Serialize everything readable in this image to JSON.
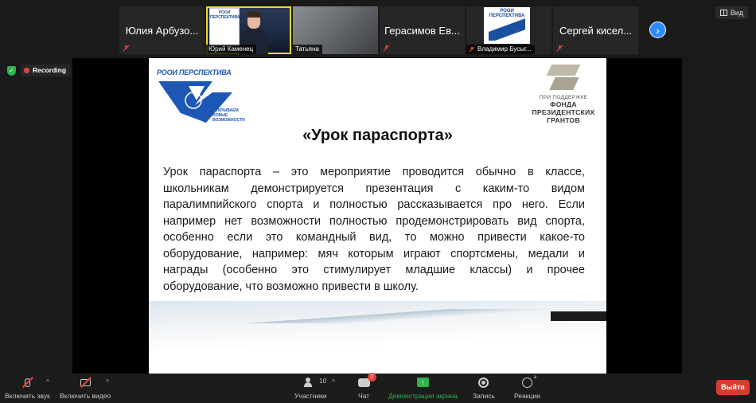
{
  "participants": [
    {
      "name": "Юлия Арбузо...",
      "type": "name-only"
    },
    {
      "name": "Юрий Каменец",
      "type": "video",
      "poster_text": "РООИ ПЕРСПЕКТИВА"
    },
    {
      "name": "Татьяна",
      "type": "video"
    },
    {
      "name": "Герасимов Ев...",
      "type": "name-only"
    },
    {
      "name": "Владимир Бусыг...",
      "type": "logo",
      "logo_text": "РООИ ПЕРСПЕКТИВА"
    },
    {
      "name": "Сергей кисел...",
      "type": "name-only"
    }
  ],
  "view_label": "Вид",
  "recording_label": "Recording",
  "slide": {
    "org_logo_text": "РООИ ПЕРСПЕКТИВА",
    "org_logo_sub": "ОТКРЫВАЕМ НОВЫЕ ВОЗМОЖНОСТИ",
    "fund_pre": "ПРИ ПОДДЕРЖКЕ",
    "fund_name_1": "ФОНДА",
    "fund_name_2": "ПРЕЗИДЕНТСКИХ",
    "fund_name_3": "ГРАНТОВ",
    "title": "«Урок параспорта»",
    "body": "Урок параспорта – это мероприятие проводится обычно в классе, школьникам демонстрируется презентация с каким-то видом паралимпийского спорта и полностью рассказывается про него. Если например нет возможности полностью продемонстрировать вид спорта, особенно если это командный вид, то можно привести какое-то оборудование, например: мяч которым играют спортсмены, медали и награды (особенно это стимулирует младшие классы) и прочее оборудование, что возможно привести в школу."
  },
  "toolbar": {
    "mute_label": "Включить звук",
    "video_label": "Включить видео",
    "participants_label": "Участники",
    "participants_count": "10",
    "chat_label": "Чат",
    "chat_badge": "2",
    "share_label": "Демонстрация экрана",
    "record_label": "Запись",
    "reactions_label": "Реакции",
    "leave_label": "Выйти"
  },
  "colors": {
    "accent": "#2d8cff",
    "share_green": "#2fb34a",
    "leave_red": "#d93b30",
    "speaker_highlight": "#f2d72f"
  }
}
